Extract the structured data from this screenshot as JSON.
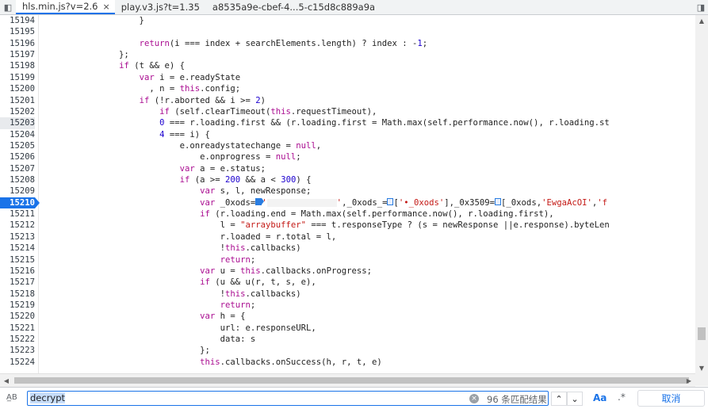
{
  "tabs": [
    {
      "label": "hls.min.js?v=2.6",
      "active": true,
      "close": "×"
    },
    {
      "label": "play.v3.js?t=1.35",
      "active": false
    },
    {
      "label": "a8535a9e-cbef-4...5-c15d8c889a9a",
      "active": false
    }
  ],
  "tabbar": {
    "left_icon": "◧",
    "right_icon": "◨"
  },
  "editor": {
    "highlighted_line": "15210",
    "current_line": "15203",
    "line_numbers": [
      "15194",
      "15195",
      "15196",
      "15197",
      "15198",
      "15199",
      "15200",
      "15201",
      "15202",
      "15203",
      "15204",
      "15205",
      "15206",
      "15207",
      "15208",
      "15209",
      "15210",
      "15211",
      "15212",
      "15213",
      "15214",
      "15215",
      "15216",
      "15217",
      "15218",
      "15219",
      "15220",
      "15221",
      "15222",
      "15223",
      "15224"
    ],
    "lines": [
      [
        {
          "t": "                    }"
        }
      ],
      [
        {
          "t": ""
        }
      ],
      [
        {
          "t": "                    "
        },
        {
          "t": "return",
          "c": "kw"
        },
        {
          "t": "(i === index + searchElements.length) ? index : -"
        },
        {
          "t": "1",
          "c": "num"
        },
        {
          "t": ";"
        }
      ],
      [
        {
          "t": "                };"
        }
      ],
      [
        {
          "t": "                "
        },
        {
          "t": "if",
          "c": "kw"
        },
        {
          "t": " (t && e) {"
        }
      ],
      [
        {
          "t": "                    "
        },
        {
          "t": "var",
          "c": "kw"
        },
        {
          "t": " i = e.readyState"
        }
      ],
      [
        {
          "t": "                      , n = "
        },
        {
          "t": "this",
          "c": "kw"
        },
        {
          "t": ".config;"
        }
      ],
      [
        {
          "t": "                    "
        },
        {
          "t": "if",
          "c": "kw"
        },
        {
          "t": " (!r.aborted && i >= "
        },
        {
          "t": "2",
          "c": "num"
        },
        {
          "t": ")"
        }
      ],
      [
        {
          "t": "                        "
        },
        {
          "t": "if",
          "c": "kw"
        },
        {
          "t": " (self.clearTimeout("
        },
        {
          "t": "this",
          "c": "kw"
        },
        {
          "t": ".requestTimeout),"
        }
      ],
      [
        {
          "t": "                        "
        },
        {
          "t": "0",
          "c": "num"
        },
        {
          "t": " === r.loading.first && (r.loading.first = Math.max(self.performance.now(), r.loading.st"
        }
      ],
      [
        {
          "t": "                        "
        },
        {
          "t": "4",
          "c": "num"
        },
        {
          "t": " === i) {"
        }
      ],
      [
        {
          "t": "                            e.onreadystatechange = "
        },
        {
          "t": "null",
          "c": "kw"
        },
        {
          "t": ","
        }
      ],
      [
        {
          "t": "                                e.onprogress = "
        },
        {
          "t": "null",
          "c": "kw"
        },
        {
          "t": ";"
        }
      ],
      [
        {
          "t": "                            "
        },
        {
          "t": "var",
          "c": "kw"
        },
        {
          "t": " a = e.status;"
        }
      ],
      [
        {
          "t": "                            "
        },
        {
          "t": "if",
          "c": "kw"
        },
        {
          "t": " (a >= "
        },
        {
          "t": "200",
          "c": "num"
        },
        {
          "t": " && a < "
        },
        {
          "t": "300",
          "c": "num"
        },
        {
          "t": ") {"
        }
      ],
      [
        {
          "t": "                                "
        },
        {
          "t": "var",
          "c": "kw"
        },
        {
          "t": " s, l, newResponse;"
        }
      ],
      [
        {
          "t": "                                "
        },
        {
          "t": "var",
          "c": "kw"
        },
        {
          "t": " _0xods="
        },
        {
          "t": "",
          "c": "bp"
        },
        {
          "t": "'",
          "c": "str"
        },
        {
          "t": "",
          "c": "blank"
        },
        {
          "t": "'",
          "c": "str"
        },
        {
          "t": ",_0xods_="
        },
        {
          "t": "",
          "c": "bpo"
        },
        {
          "t": "["
        },
        {
          "t": "'•_0xods'",
          "c": "str"
        },
        {
          "t": "],_0x3509="
        },
        {
          "t": "",
          "c": "bpo"
        },
        {
          "t": "[_0xods,"
        },
        {
          "t": "'EwgaAcOI'",
          "c": "str"
        },
        {
          "t": ","
        },
        {
          "t": "'f",
          "c": "str"
        }
      ],
      [
        {
          "t": "                                "
        },
        {
          "t": "if",
          "c": "kw"
        },
        {
          "t": " (r.loading.end = Math.max(self.performance.now(), r.loading.first),"
        }
      ],
      [
        {
          "t": "                                    l = "
        },
        {
          "t": "\"arraybuffer\"",
          "c": "str"
        },
        {
          "t": " === t.responseType ? (s = newResponse ||e.response).byteLen"
        }
      ],
      [
        {
          "t": "                                    r.loaded = r.total = l,"
        }
      ],
      [
        {
          "t": "                                    !"
        },
        {
          "t": "this",
          "c": "kw"
        },
        {
          "t": ".callbacks)"
        }
      ],
      [
        {
          "t": "                                    "
        },
        {
          "t": "return",
          "c": "kw"
        },
        {
          "t": ";"
        }
      ],
      [
        {
          "t": "                                "
        },
        {
          "t": "var",
          "c": "kw"
        },
        {
          "t": " u = "
        },
        {
          "t": "this",
          "c": "kw"
        },
        {
          "t": ".callbacks.onProgress;"
        }
      ],
      [
        {
          "t": "                                "
        },
        {
          "t": "if",
          "c": "kw"
        },
        {
          "t": " (u && u(r, t, s, e),"
        }
      ],
      [
        {
          "t": "                                    !"
        },
        {
          "t": "this",
          "c": "kw"
        },
        {
          "t": ".callbacks)"
        }
      ],
      [
        {
          "t": "                                    "
        },
        {
          "t": "return",
          "c": "kw"
        },
        {
          "t": ";"
        }
      ],
      [
        {
          "t": "                                "
        },
        {
          "t": "var",
          "c": "kw"
        },
        {
          "t": " h = {"
        }
      ],
      [
        {
          "t": "                                    url: e.responseURL,"
        }
      ],
      [
        {
          "t": "                                    data: s"
        }
      ],
      [
        {
          "t": "                                };"
        }
      ],
      [
        {
          "t": "                                "
        },
        {
          "t": "this",
          "c": "kw"
        },
        {
          "t": ".callbacks.onSuccess(h, r, t, e)"
        }
      ]
    ]
  },
  "scrollbars": {
    "up": "▲",
    "down": "▼",
    "left": "◀",
    "right": "▶"
  },
  "search": {
    "mode_icon": "A̲B",
    "value": "decrypt",
    "clear_icon": "×",
    "match_count": "96 条匹配结果",
    "prev": "⌃",
    "next": "⌄",
    "match_case": "Aa",
    "regex": ".*",
    "cancel": "取消"
  }
}
